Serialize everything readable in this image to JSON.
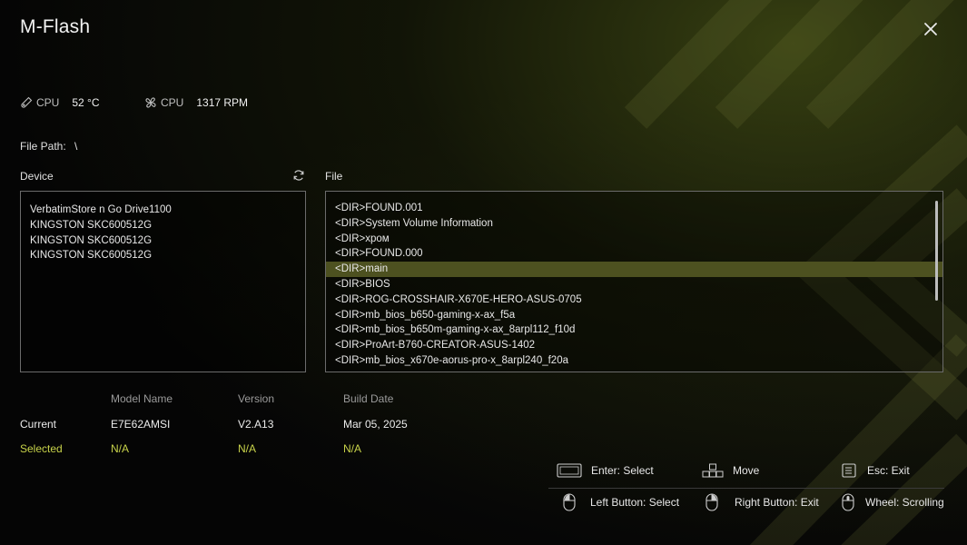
{
  "window": {
    "title": "M-Flash"
  },
  "sensors": {
    "cpu_temp": {
      "label": "CPU",
      "value": "52 °C",
      "icon": "thermometer-icon"
    },
    "cpu_fan": {
      "label": "CPU",
      "value": "1317 RPM",
      "icon": "fan-icon"
    }
  },
  "file_path": {
    "label": "File Path:",
    "value": "\\"
  },
  "device": {
    "label": "Device",
    "items": [
      "VerbatimStore n Go Drive1100",
      "KINGSTON SKC600512G",
      "KINGSTON SKC600512G",
      "KINGSTON SKC600512G"
    ]
  },
  "file": {
    "label": "File",
    "selected_index": 4,
    "items": [
      "<DIR>FOUND.001",
      "<DIR>System Volume Information",
      "<DIR>хром",
      "<DIR>FOUND.000",
      "<DIR>main",
      "<DIR>BIOS",
      "<DIR>ROG-CROSSHAIR-X670E-HERO-ASUS-0705",
      "<DIR>mb_bios_b650-gaming-x-ax_f5a",
      "<DIR>mb_bios_b650m-gaming-x-ax_8arpl112_f10d",
      "<DIR>ProArt-B760-CREATOR-ASUS-1402",
      "<DIR>mb_bios_x670e-aorus-pro-x_8arpl240_f20a"
    ]
  },
  "bios_info": {
    "headers": {
      "model": "Model Name",
      "version": "Version",
      "build": "Build Date"
    },
    "current": {
      "label": "Current",
      "model": "E7E62AMSI",
      "version": "V2.A13",
      "build": "Mar 05, 2025"
    },
    "selected": {
      "label": "Selected",
      "model": "N/A",
      "version": "N/A",
      "build": "N/A"
    }
  },
  "hints": {
    "enter": "Enter: Select",
    "move": "Move",
    "esc": "Esc: Exit",
    "left": "Left Button: Select",
    "right": "Right Button: Exit",
    "wheel": "Wheel: Scrolling"
  },
  "colors": {
    "accent": "#c8d34a",
    "selected_row": "#4d5120",
    "background": "#050505"
  }
}
